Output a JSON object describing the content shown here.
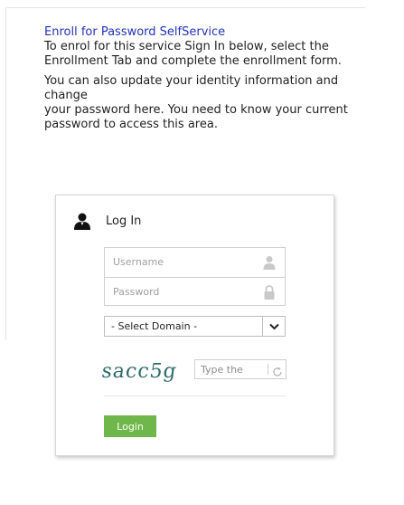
{
  "intro": {
    "link_text": "Enroll for Password SelfService",
    "paragraph1_lines": [
      "To enrol for this service Sign In below, select the",
      "Enrollment Tab and complete the enrollment form."
    ],
    "paragraph2_lines": [
      "You can also update your identity information and",
      "change",
      "your password here. You need to know your current",
      "password to access this area."
    ]
  },
  "login": {
    "title": "Log In",
    "username_placeholder": "Username",
    "password_placeholder": "Password",
    "domain_selected": "- Select Domain -",
    "captcha_text": "sacc5g",
    "captcha_placeholder": "Type the",
    "button_label": "Login"
  },
  "colors": {
    "link": "#1f34b8",
    "login_button": "#70b74b",
    "captcha_ink": "#2e6b6b"
  },
  "icons": {
    "header": "user-icon",
    "username": "person-icon",
    "password": "lock-icon",
    "select": "chevron-down-icon",
    "captcha": "refresh-icon"
  }
}
